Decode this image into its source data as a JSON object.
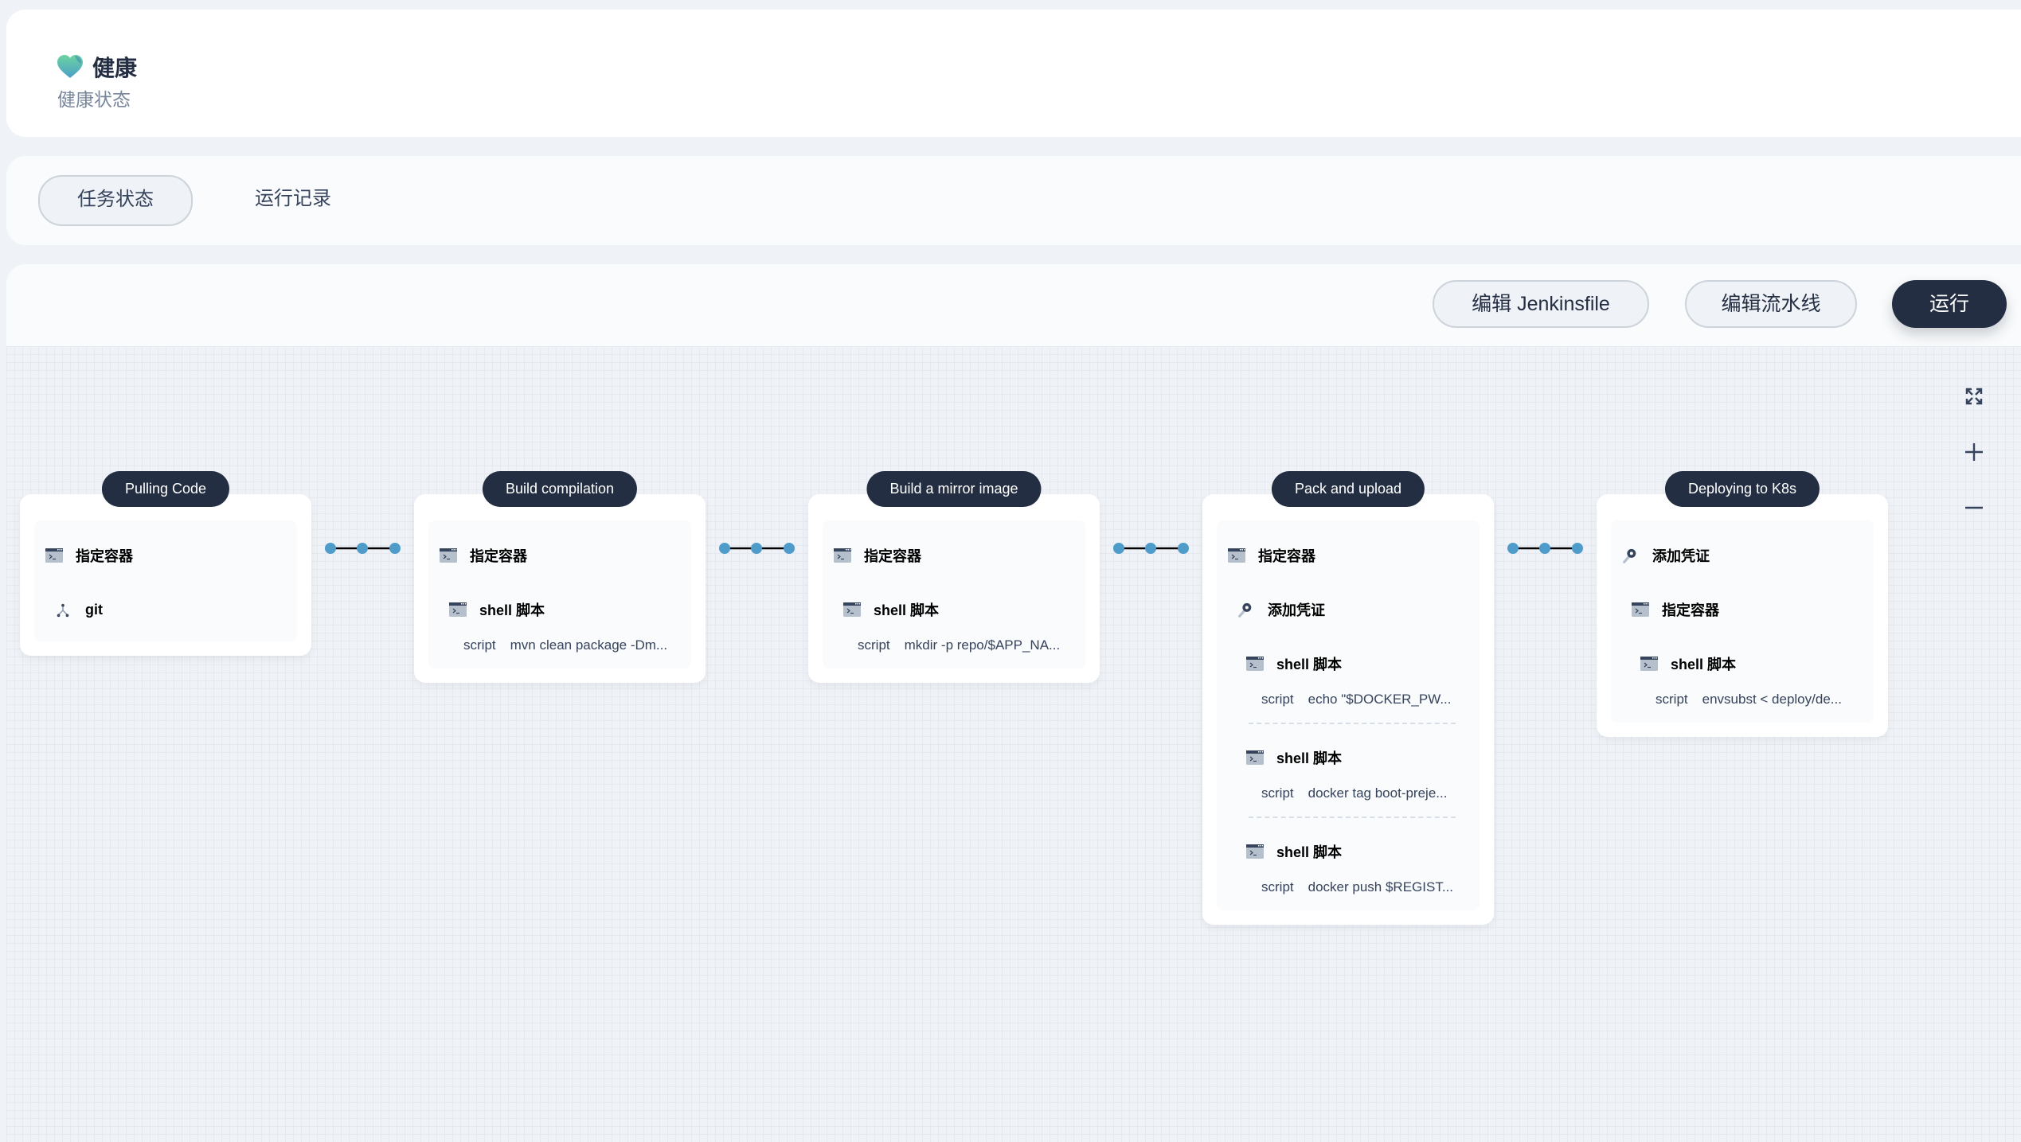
{
  "header": {
    "status_icon": "heart-icon",
    "status_title": "健康",
    "status_subtitle": "健康状态",
    "heart_colors": [
      "#6dd3a0",
      "#4a9fc9"
    ]
  },
  "tabs": [
    {
      "label": "任务状态",
      "active": true
    },
    {
      "label": "运行记录",
      "active": false
    }
  ],
  "toolbar": {
    "edit_jenkinsfile_label": "编辑 Jenkinsfile",
    "edit_pipeline_label": "编辑流水线",
    "run_label": "运行"
  },
  "canvas_controls": [
    {
      "icon": "fullscreen-icon"
    },
    {
      "icon": "zoom-in-icon"
    },
    {
      "icon": "zoom-out-icon"
    }
  ],
  "colors": {
    "primary": "#242e42",
    "connector": "#4f9bc9",
    "background": "#eff2f6"
  },
  "stages": [
    {
      "name": "Pulling Code",
      "steps": [
        {
          "icon": "terminal-icon",
          "label": "指定容器",
          "level": 0
        },
        {
          "icon": "git-icon",
          "label": "git",
          "level": 1
        }
      ]
    },
    {
      "name": "Build compilation",
      "steps": [
        {
          "icon": "terminal-icon",
          "label": "指定容器",
          "level": 0
        },
        {
          "icon": "terminal-icon",
          "label": "shell 脚本",
          "level": 1,
          "script_key": "script",
          "script": "mvn clean package -Dm..."
        }
      ]
    },
    {
      "name": "Build a mirror image",
      "steps": [
        {
          "icon": "terminal-icon",
          "label": "指定容器",
          "level": 0
        },
        {
          "icon": "terminal-icon",
          "label": "shell 脚本",
          "level": 1,
          "script_key": "script",
          "script": "mkdir -p repo/$APP_NA..."
        }
      ]
    },
    {
      "name": "Pack and upload",
      "steps": [
        {
          "icon": "terminal-icon",
          "label": "指定容器",
          "level": 0
        },
        {
          "icon": "key-icon",
          "label": "添加凭证",
          "level": 1
        },
        {
          "icon": "terminal-icon",
          "label": "shell 脚本",
          "level": 2,
          "script_key": "script",
          "script": "echo \"$DOCKER_PW..."
        },
        {
          "icon": "terminal-icon",
          "label": "shell 脚本",
          "level": 2,
          "script_key": "script",
          "script": "docker tag boot-preje..."
        },
        {
          "icon": "terminal-icon",
          "label": "shell 脚本",
          "level": 2,
          "script_key": "script",
          "script": "docker push $REGIST..."
        }
      ]
    },
    {
      "name": "Deploying to K8s",
      "steps": [
        {
          "icon": "key-icon",
          "label": "添加凭证",
          "level": 0
        },
        {
          "icon": "terminal-icon",
          "label": "指定容器",
          "level": 1
        },
        {
          "icon": "terminal-icon",
          "label": "shell 脚本",
          "level": 2,
          "script_key": "script",
          "script": "envsubst < deploy/de..."
        }
      ]
    }
  ]
}
